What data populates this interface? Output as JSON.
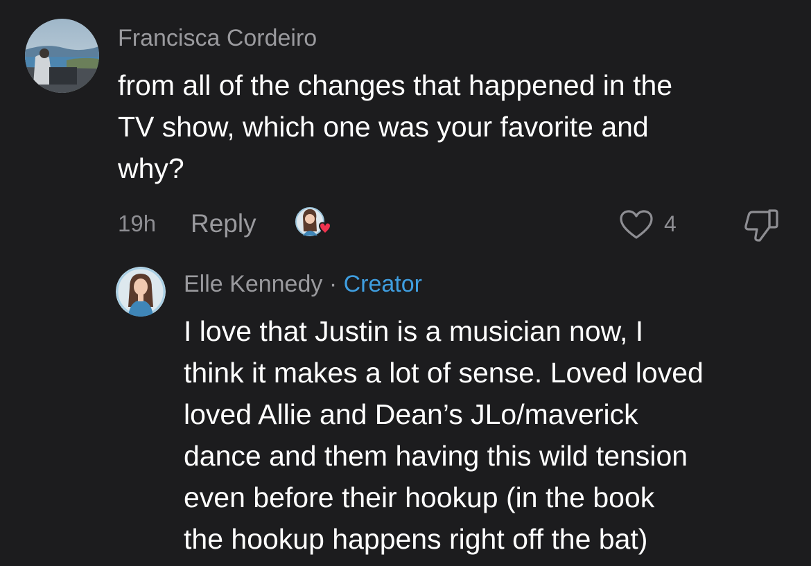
{
  "comment": {
    "username": "Francisca Cordeiro",
    "text_lines": [
      "from all of the changes that happened in the",
      "TV show, which one was your favorite and",
      "why?"
    ],
    "time": "19h",
    "reply_label": "Reply",
    "like_count": "4",
    "icons": {
      "avatar": "user-avatar",
      "creator_liked": "creator-liked-heart-icon",
      "like": "heart-outline-icon",
      "dislike": "thumbs-down-icon"
    }
  },
  "reply": {
    "username": "Elle Kennedy",
    "separator": "·",
    "badge": "Creator",
    "text_lines": [
      "I love that Justin is a musician now, I",
      "think it makes a lot of sense. Loved loved",
      "loved Allie and Dean’s JLo/maverick",
      "dance and them having this wild tension",
      "even before their hookup (in the book",
      "the hookup happens right off the bat)"
    ]
  },
  "colors": {
    "background": "#1c1c1e",
    "text": "#ffffff",
    "muted": "#9a9a9e",
    "creator": "#3f9ee0",
    "heart_red": "#f0334f"
  }
}
